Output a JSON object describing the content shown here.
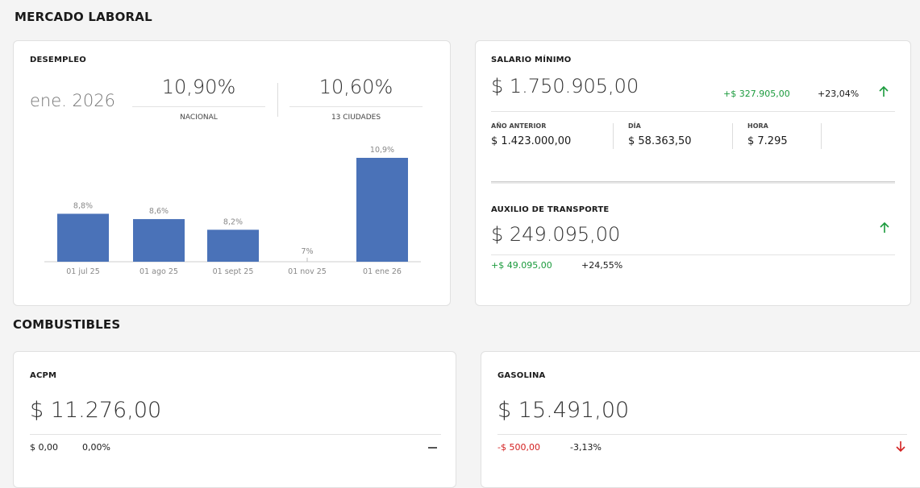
{
  "sections": {
    "mercado_laboral": "MERCADO LABORAL",
    "combustibles": "COMBUSTIBLES"
  },
  "desempleo": {
    "title": "DESEMPLEO",
    "period": "ene. 2026",
    "nacional_value": "10,90%",
    "nacional_label": "NACIONAL",
    "ciudades_value": "10,60%",
    "ciudades_label": "13 CIUDADES"
  },
  "chart_data": {
    "type": "bar",
    "categories": [
      "01 jul 25",
      "01 ago 25",
      "01 sept 25",
      "01 nov 25",
      "01 ene 26"
    ],
    "values": [
      8.8,
      8.6,
      8.2,
      7.0,
      10.9
    ],
    "data_labels": [
      "8,8%",
      "8,6%",
      "8,2%",
      "7%",
      "10,9%"
    ],
    "color": "#4a72b8",
    "title": "",
    "xlabel": "",
    "ylabel": "",
    "grid": false
  },
  "salario": {
    "title": "SALARIO MÍNIMO",
    "value": "$ 1.750.905,00",
    "change_abs": "+$ 327.905,00",
    "change_pct": "+23,04%",
    "trend_icon": "arrow-up-icon",
    "anio_anterior_label": "AÑO ANTERIOR",
    "anio_anterior_value": "$ 1.423.000,00",
    "dia_label": "DÍA",
    "dia_value": "$ 58.363,50",
    "hora_label": "HORA",
    "hora_value": "$ 7.295"
  },
  "auxilio": {
    "title": "AUXILIO DE TRANSPORTE",
    "value": "$ 249.095,00",
    "change_abs": "+$ 49.095,00",
    "change_pct": "+24,55%",
    "trend_icon": "arrow-up-icon"
  },
  "acpm": {
    "title": "ACPM",
    "value": "$ 11.276,00",
    "change_abs": "$ 0,00",
    "change_pct": "0,00%",
    "trend_icon": "dash-icon"
  },
  "gasolina": {
    "title": "GASOLINA",
    "value": "$ 15.491,00",
    "change_abs": "-$ 500,00",
    "change_pct": "-3,13%",
    "trend_icon": "arrow-down-icon"
  },
  "colors": {
    "positive": "#1a9a3c",
    "negative": "#d32020",
    "bar": "#4a72b8"
  }
}
